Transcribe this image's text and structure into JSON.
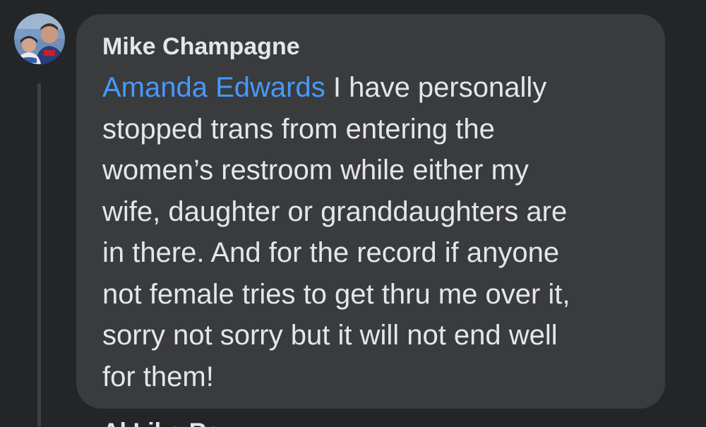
{
  "comment": {
    "author": "Mike Champagne",
    "mention": "Amanda Edwards",
    "lines": [
      " I have personally",
      "stopped trans from entering the",
      "women’s restroom while either my",
      "wife, daughter or granddaughters are",
      "in there. And for the record if anyone",
      "not female tries to get thru me over it,",
      "sorry not sorry but it will not end well",
      "for them!"
    ]
  },
  "next_comment": {
    "author_partial": "Al    Liko    Re"
  },
  "colors": {
    "background": "#242526",
    "bubble": "#3a3b3c",
    "text": "#e4e6eb",
    "mention": "#4599ff",
    "thread_line": "#3e4042"
  },
  "icons": {
    "avatar": "profile-photo-avatar"
  }
}
